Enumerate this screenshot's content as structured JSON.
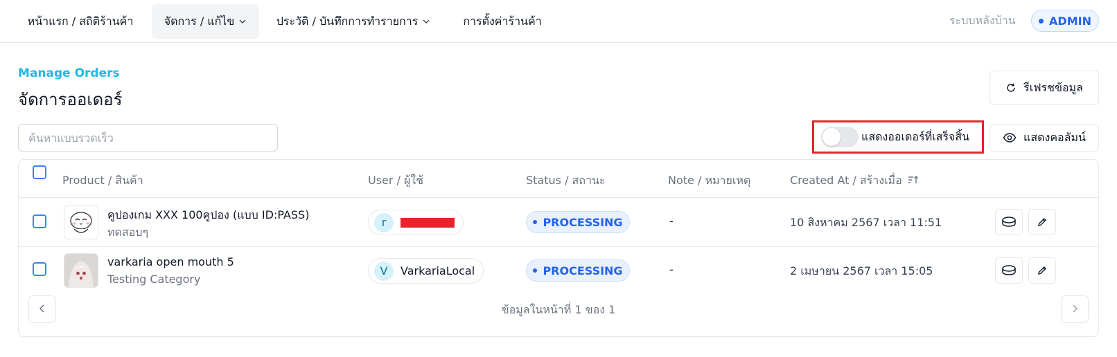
{
  "nav": {
    "items": [
      {
        "label": "หน้าแรก / สถิติร้านค้า"
      },
      {
        "label": "จัดการ / แก้ไข"
      },
      {
        "label": "ประวัติ / บันทึกการทำรายการ"
      },
      {
        "label": "การตั้งค่าร้านค้า"
      }
    ],
    "backend_label": "ระบบหลังบ้าน",
    "admin_badge": "ADMIN"
  },
  "header": {
    "subtitle": "Manage Orders",
    "title": "จัดการออเดอร์",
    "refresh_label": "รีเฟรชข้อมูล"
  },
  "toolbar": {
    "search_placeholder": "ค้นหาแบบรวดเร็ว",
    "show_completed_label": "แสดงออเดอร์ที่เสร็จสิ้น",
    "show_completed_on": false,
    "columns_label": "แสดงคอลัมน์"
  },
  "table": {
    "headers": {
      "product": "Product / สินค้า",
      "user": "User / ผู้ใช้",
      "status": "Status / สถานะ",
      "note": "Note / หมายเหตุ",
      "created": "Created At / สร้างเมื่อ"
    },
    "rows": [
      {
        "product_name": "คูปองเกม XXX 100คูปอง (แบบ ID:PASS)",
        "product_category": "ทดสอบๆ",
        "user_initial": "r",
        "user_name": "",
        "status": "PROCESSING",
        "note": "-",
        "created_at": "10 สิงหาคม 2567 เวลา 11:51"
      },
      {
        "product_name": "varkaria open mouth 5",
        "product_category": "Testing Category",
        "user_initial": "V",
        "user_name": "VarkariaLocal",
        "status": "PROCESSING",
        "note": "-",
        "created_at": "2 เมษายน 2567 เวลา 15:05"
      }
    ]
  },
  "pagination": {
    "text": "ข้อมูลในหน้าที่ 1 ของ 1"
  },
  "colors": {
    "accent": "#22b8e6",
    "status_blue": "#2563eb",
    "highlight_red": "#e3262a"
  }
}
